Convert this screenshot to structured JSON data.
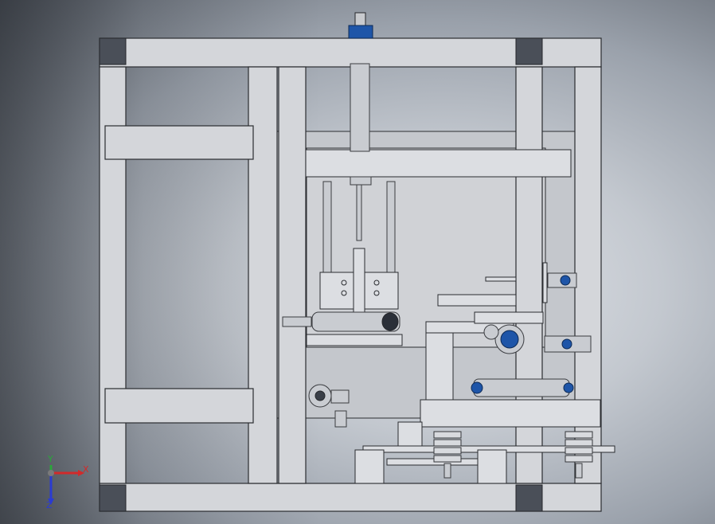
{
  "viewport": {
    "background_accent": "#9aa1ab",
    "frame_color": "#d4d6da",
    "blue_part_color": "#1e55a8"
  },
  "triad": {
    "x_label": "X",
    "y_label": "Y",
    "z_label": "Z",
    "x_color": "#d22a2a",
    "y_color": "#2aa63a",
    "z_color": "#2a3bd2"
  }
}
